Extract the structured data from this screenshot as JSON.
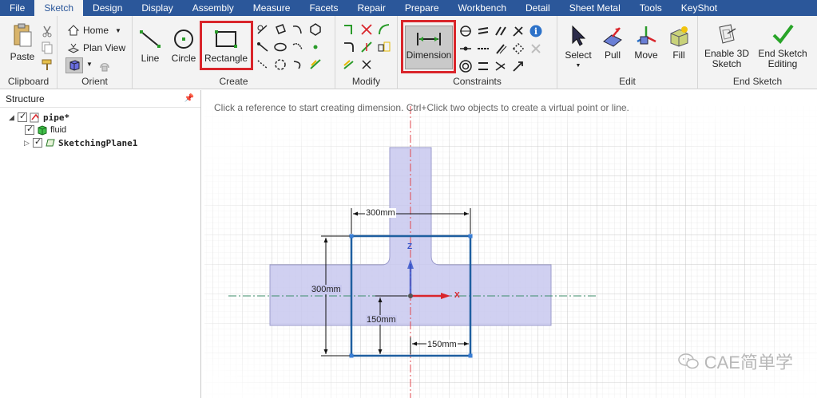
{
  "menu": {
    "tabs": [
      "File",
      "Sketch",
      "Design",
      "Display",
      "Assembly",
      "Measure",
      "Facets",
      "Repair",
      "Prepare",
      "Workbench",
      "Detail",
      "Sheet Metal",
      "Tools",
      "KeyShot"
    ],
    "active": "Sketch"
  },
  "ribbon": {
    "clipboard": {
      "paste": "Paste",
      "label": "Clipboard"
    },
    "orient": {
      "home": "Home",
      "plan_view": "Plan View",
      "label": "Orient"
    },
    "create": {
      "line": "Line",
      "circle": "Circle",
      "rectangle": "Rectangle",
      "label": "Create"
    },
    "modify": {
      "label": "Modify"
    },
    "constraints": {
      "dimension": "Dimension",
      "label": "Constraints"
    },
    "edit": {
      "select": "Select",
      "pull": "Pull",
      "move": "Move",
      "fill": "Fill",
      "label": "Edit"
    },
    "end_sketch": {
      "enable_3d_line1": "Enable 3D",
      "enable_3d_line2": "Sketch",
      "end_editing_line1": "End Sketch",
      "end_editing_line2": "Editing",
      "label": "End Sketch"
    }
  },
  "structure": {
    "title": "Structure",
    "items": [
      {
        "label": "pipe*"
      },
      {
        "label": "fluid"
      },
      {
        "label": "SketchingPlane1"
      }
    ]
  },
  "canvas": {
    "hint": "Click a reference to start creating dimension. Ctrl+Click two objects to create a virtual point or line.",
    "dims": {
      "top": "300mm",
      "left": "300mm",
      "inner_vertical": "150mm",
      "bottom": "150mm"
    },
    "axes": {
      "x": "X",
      "z": "Z"
    }
  },
  "watermark": "CAE简单学",
  "colors": {
    "menubar": "#2b579a",
    "highlight": "#d9252b",
    "sketch_rect": "#1f5fa0",
    "body_fill": "#c8c8ee"
  }
}
